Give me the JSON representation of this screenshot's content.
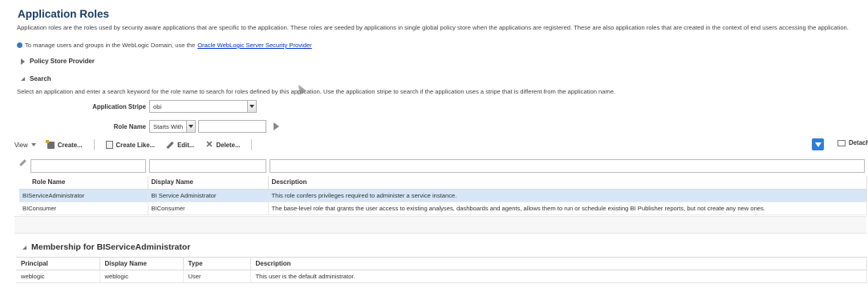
{
  "page": {
    "title": "Application Roles",
    "intro": "Application roles are the roles used by security aware applications that are specific to the application. These roles are seeded by applications in single global policy store when the applications are registered. These are also application roles that are created in the context of end users accessing the application.",
    "manage_prefix": "To manage users and groups in the WebLogic Domain, use the",
    "manage_link": "Oracle WebLogic Server Security Provider"
  },
  "policy_store": {
    "label": "Policy Store Provider"
  },
  "search": {
    "label": "Search",
    "hint": "Select an application and enter a search keyword for the role name to search for roles defined by this application. Use the application stripe to search if the application uses a stripe that is different from the application name.",
    "app_stripe_label": "Application Stripe",
    "app_stripe_value": "obi",
    "role_name_label": "Role Name",
    "role_name_operator": "Starts With",
    "role_name_value": ""
  },
  "toolbar": {
    "view": "View",
    "create": "Create...",
    "create_like": "Create Like...",
    "edit": "Edit...",
    "delete": "Delete...",
    "detach": "Detach"
  },
  "roles_table": {
    "columns": [
      "Role Name",
      "Display Name",
      "Description"
    ],
    "rows": [
      [
        "BIServiceAdministrator",
        "BI Service Administrator",
        "This role confers privileges required to administer a service instance."
      ],
      [
        "BIConsumer",
        "BIConsumer",
        "The base-level role that grants the user access to existing analyses, dashboards and agents, allows them to run or schedule existing BI Publisher reports, but not create any new ones."
      ]
    ]
  },
  "membership": {
    "title": "Membership for BIServiceAdministrator",
    "columns": [
      "Principal",
      "Display Name",
      "Type",
      "Description"
    ],
    "rows": [
      [
        "weblogic",
        "weblogic",
        "User",
        "This user is the default administrator."
      ]
    ]
  },
  "colors": {
    "title": "#1a3d66",
    "link": "#0033cc",
    "selected_row": "#d6e6f7",
    "accent": "#2f7ed8"
  }
}
